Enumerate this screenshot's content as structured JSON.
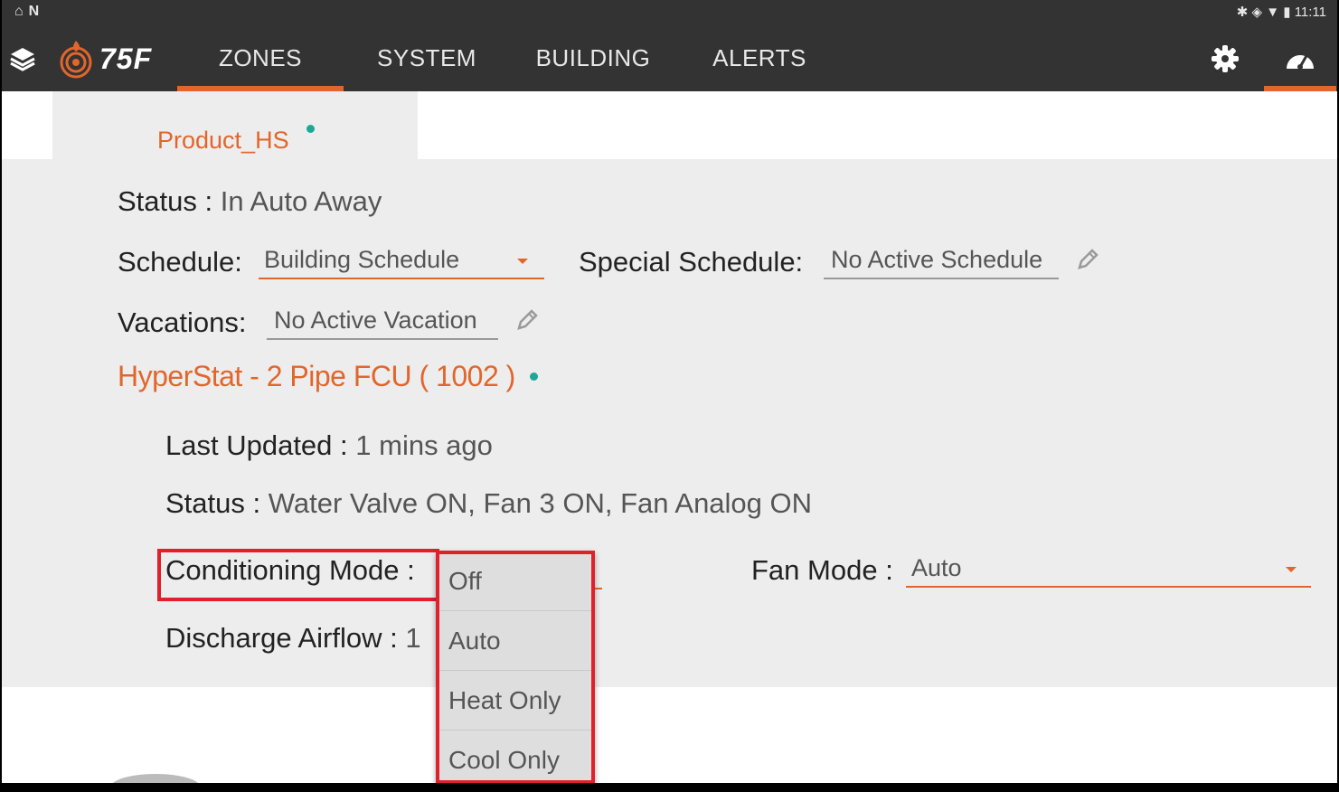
{
  "statusbar": {
    "left_icons": [
      "home-outline-icon",
      "n-icon"
    ],
    "right_icons": [
      "bluetooth-icon",
      "vibrate-icon",
      "wifi-icon",
      "battery-icon"
    ],
    "time": "11:11"
  },
  "nav": {
    "logo_text": "75F",
    "tabs": [
      {
        "label": "ZONES",
        "active": true
      },
      {
        "label": "SYSTEM",
        "active": false
      },
      {
        "label": "BUILDING",
        "active": false
      },
      {
        "label": "ALERTS",
        "active": false
      }
    ]
  },
  "zone": {
    "name": "Product_HS",
    "status_label": "Status :",
    "status_value": "In Auto Away",
    "schedule_label": "Schedule:",
    "schedule_value": "Building Schedule",
    "special_schedule_label": "Special Schedule:",
    "special_schedule_value": "No Active Schedule",
    "vacations_label": "Vacations:",
    "vacations_value": "No Active Vacation"
  },
  "equipment": {
    "title": "HyperStat -  2 Pipe FCU ( 1002 )",
    "last_updated_label": "Last Updated :",
    "last_updated_value": "1 mins ago",
    "status_label": "Status :",
    "status_value": "Water Valve ON, Fan 3 ON, Fan Analog ON",
    "conditioning_mode_label": "Conditioning Mode :",
    "fan_mode_label": "Fan Mode :",
    "fan_mode_value": "Auto",
    "discharge_label": "Discharge Airflow :",
    "discharge_value_partial": "1"
  },
  "conditioning_options": [
    "Off",
    "Auto",
    "Heat Only",
    "Cool Only"
  ],
  "colors": {
    "accent": "#e2662b",
    "online_dot": "#1aa897",
    "highlight": "#e0202a",
    "nav_bg": "#333333"
  }
}
